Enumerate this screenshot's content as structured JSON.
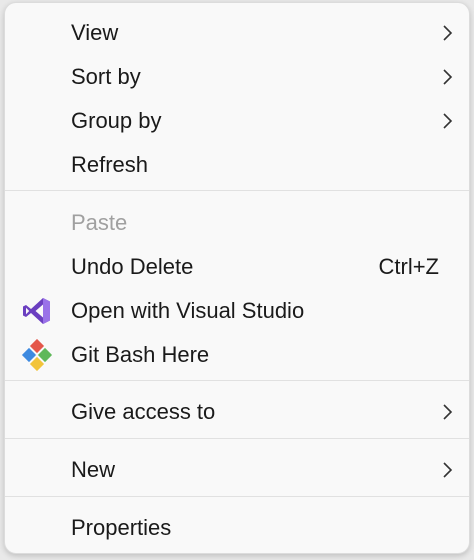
{
  "menu": {
    "items": {
      "view": {
        "label": "View",
        "icon": "chevron-right-icon"
      },
      "sort_by": {
        "label": "Sort by",
        "icon": "chevron-right-icon"
      },
      "group_by": {
        "label": "Group by",
        "icon": "chevron-right-icon"
      },
      "refresh": {
        "label": "Refresh"
      },
      "paste": {
        "label": "Paste",
        "disabled": true
      },
      "undo_delete": {
        "label": "Undo Delete",
        "shortcut": "Ctrl+Z"
      },
      "open_with_vs": {
        "label": "Open with Visual Studio",
        "icon": "visual-studio-icon"
      },
      "git_bash_here": {
        "label": "Git Bash Here",
        "icon": "git-icon"
      },
      "give_access_to": {
        "label": "Give access to",
        "icon": "chevron-right-icon"
      },
      "new": {
        "label": "New",
        "icon": "chevron-right-icon"
      },
      "properties": {
        "label": "Properties"
      }
    }
  },
  "colors": {
    "menu_bg": "#f9f9f9",
    "text": "#1a1a1a",
    "disabled_text": "#a0a0a0",
    "separator": "#e1e1e1",
    "vs_purple": "#7b4fcf",
    "git_green": "#5fb85a",
    "git_blue": "#3e8ae0",
    "git_red": "#e4574a",
    "git_yellow": "#f2c43a"
  }
}
